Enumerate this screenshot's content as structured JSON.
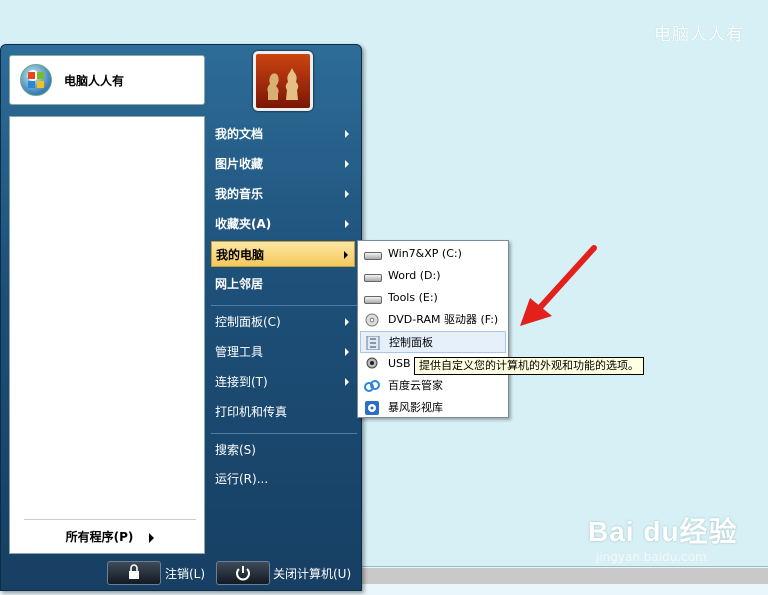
{
  "watermark_top": "电脑人人有",
  "watermark_bottom": {
    "logo": "Bai du经验",
    "url": "jingyan.baidu.com"
  },
  "user": {
    "name": "电脑人人有"
  },
  "left_pane": {
    "all_programs": "所有程序(P)"
  },
  "right_items": [
    {
      "label": "我的文档",
      "arrow": true,
      "bold": true
    },
    {
      "label": "图片收藏",
      "arrow": true,
      "bold": true
    },
    {
      "label": "我的音乐",
      "arrow": true,
      "bold": true
    },
    {
      "label": "收藏夹(A)",
      "arrow": true,
      "bold": true
    },
    {
      "label": "我的电脑",
      "arrow": true,
      "bold": true,
      "selected": true
    },
    {
      "label": "网上邻居",
      "arrow": false,
      "bold": true
    },
    {
      "label": "控制面板(C)",
      "arrow": true,
      "bold": false
    },
    {
      "label": "管理工具",
      "arrow": true,
      "bold": false
    },
    {
      "label": "连接到(T)",
      "arrow": true,
      "bold": false
    },
    {
      "label": "打印机和传真",
      "arrow": false,
      "bold": false
    },
    {
      "label": "搜索(S)",
      "arrow": false,
      "bold": false
    },
    {
      "label": "运行(R)...",
      "arrow": false,
      "bold": false
    }
  ],
  "submenu": [
    {
      "label": "Win7&XP (C:)",
      "icon": "drive-icon"
    },
    {
      "label": "Word (D:)",
      "icon": "drive-icon"
    },
    {
      "label": "Tools (E:)",
      "icon": "drive-icon"
    },
    {
      "label": "DVD-RAM 驱动器 (F:)",
      "icon": "dvd-icon"
    },
    {
      "label": "控制面板",
      "icon": "control-panel-icon",
      "selected": true
    },
    {
      "label": "USB 视频设备",
      "icon": "webcam-icon"
    },
    {
      "label": "百度云管家",
      "icon": "cloud-icon"
    },
    {
      "label": "暴风影视库",
      "icon": "media-icon"
    }
  ],
  "tooltip": "提供自定义您的计算机的外观和功能的选项。",
  "footer": {
    "logoff": "注销(L)",
    "shutdown": "关闭计算机(U)"
  },
  "colors": {
    "highlight": "#f4c95b",
    "menu_blue": "#1d4f78",
    "arrow_red": "#e3201b"
  }
}
